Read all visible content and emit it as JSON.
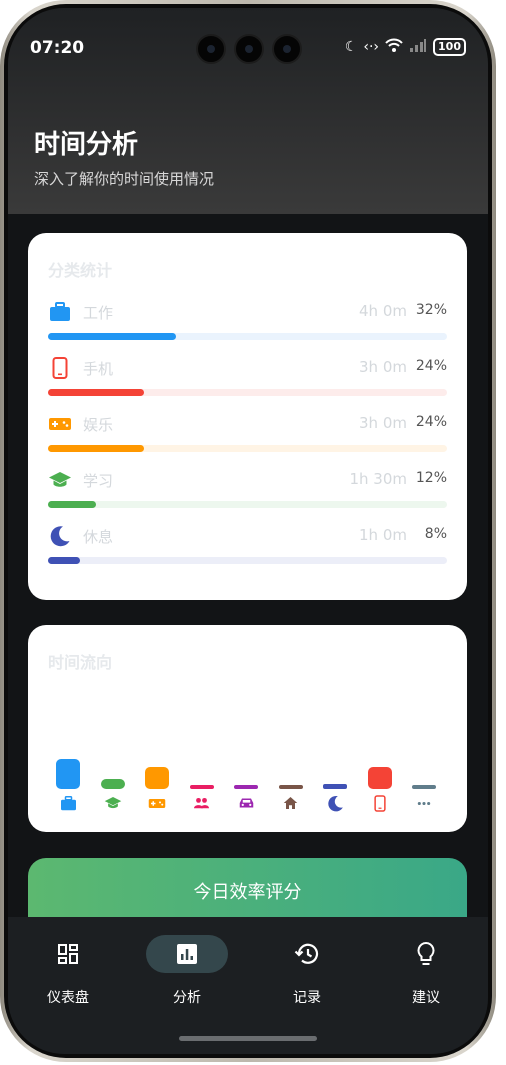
{
  "status_bar": {
    "time": "07:20",
    "battery": "100"
  },
  "header": {
    "title": "时间分析",
    "subtitle": "深入了解你的时间使用情况"
  },
  "category_stats": {
    "title": "分类统计",
    "items": [
      {
        "name": "工作",
        "duration": "4h 0m",
        "percent": "32%",
        "fraction": 0.32,
        "color": "#2196f3",
        "track": "#eaf3fd",
        "icon": "briefcase-icon"
      },
      {
        "name": "手机",
        "duration": "3h 0m",
        "percent": "24%",
        "fraction": 0.24,
        "color": "#f44336",
        "track": "#fdeceb",
        "icon": "phone-icon"
      },
      {
        "name": "娱乐",
        "duration": "3h 0m",
        "percent": "24%",
        "fraction": 0.24,
        "color": "#ff9800",
        "track": "#fff4e5",
        "icon": "gamepad-icon"
      },
      {
        "name": "学习",
        "duration": "1h 30m",
        "percent": "12%",
        "fraction": 0.12,
        "color": "#4caf50",
        "track": "#edf7ee",
        "icon": "graduation-cap-icon"
      },
      {
        "name": "休息",
        "duration": "1h 0m",
        "percent": "8%",
        "fraction": 0.08,
        "color": "#3f51b5",
        "track": "#eceef8",
        "icon": "moon-icon"
      }
    ]
  },
  "time_flow": {
    "title": "时间流向",
    "segments": [
      {
        "icon": "briefcase-icon",
        "color": "#2196f3",
        "level": 1.0
      },
      {
        "icon": "graduation-cap-icon",
        "color": "#4caf50",
        "level": 0.33
      },
      {
        "icon": "gamepad-icon",
        "color": "#ff9800",
        "level": 0.75
      },
      {
        "icon": "people-icon",
        "color": "#e91e63",
        "level": 0.08
      },
      {
        "icon": "car-icon",
        "color": "#9c27b0",
        "level": 0.08
      },
      {
        "icon": "home-icon",
        "color": "#795548",
        "level": 0.08
      },
      {
        "icon": "moon-icon",
        "color": "#3f51b5",
        "level": 0.17
      },
      {
        "icon": "phone-icon",
        "color": "#f44336",
        "level": 0.75
      },
      {
        "icon": "more-icon",
        "color": "#607d8b",
        "level": 0.08
      }
    ]
  },
  "efficiency": {
    "label": "今日效率评分"
  },
  "nav": {
    "active": 1,
    "items": [
      {
        "label": "仪表盘",
        "icon": "dashboard-icon"
      },
      {
        "label": "分析",
        "icon": "analytics-icon"
      },
      {
        "label": "记录",
        "icon": "history-icon"
      },
      {
        "label": "建议",
        "icon": "lightbulb-icon"
      }
    ]
  }
}
